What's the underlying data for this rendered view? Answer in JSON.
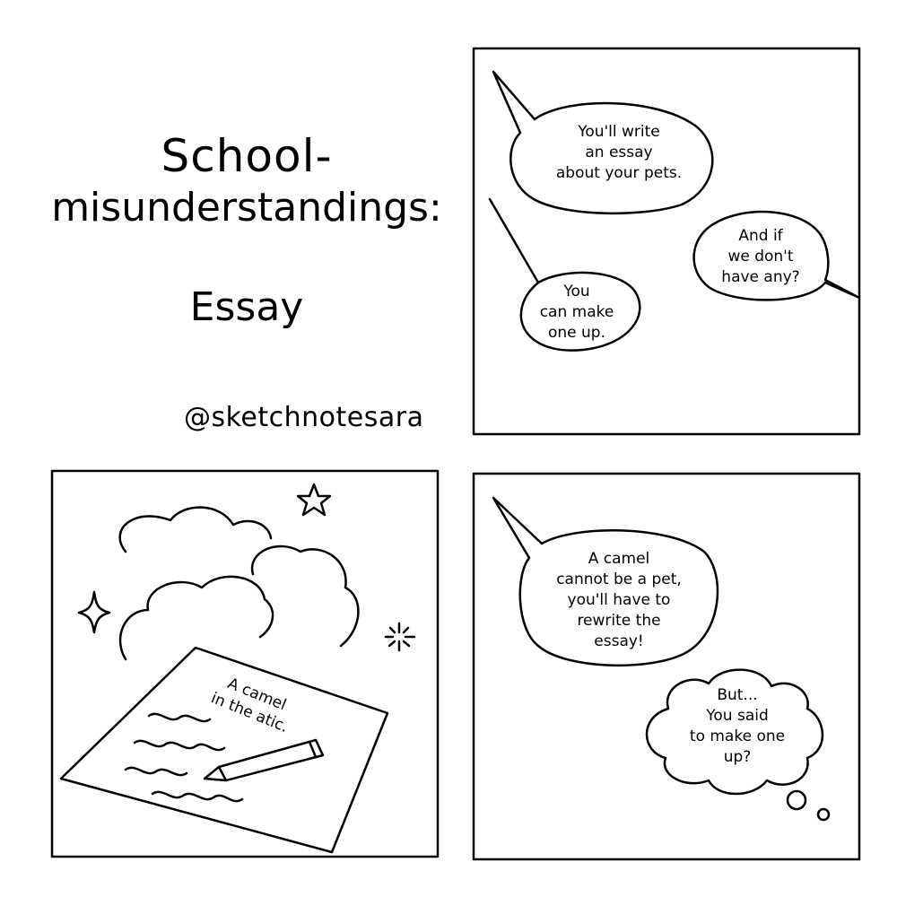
{
  "title": {
    "line1": "School-",
    "line2": "misunderstandings:",
    "subtitle": "Essay"
  },
  "handle": "@sketchnotesara",
  "panel1": {
    "bubble_teacher": [
      "You'll write",
      "an essay",
      "about your pets."
    ],
    "bubble_student": [
      "And if",
      "we don't",
      "have any?"
    ],
    "bubble_teacher_reply": [
      "You",
      "can make",
      "one up."
    ]
  },
  "panel2": {
    "paper_text": [
      "A camel",
      "in the atic."
    ]
  },
  "panel3": {
    "bubble_teacher": [
      "A camel",
      "cannot be a pet,",
      "you'll have to",
      "rewrite the",
      "essay!"
    ],
    "thought_student": [
      "But...",
      "You said",
      "to make one",
      "up?"
    ]
  },
  "colors": {
    "ink": "#000000",
    "paper": "#ffffff"
  }
}
